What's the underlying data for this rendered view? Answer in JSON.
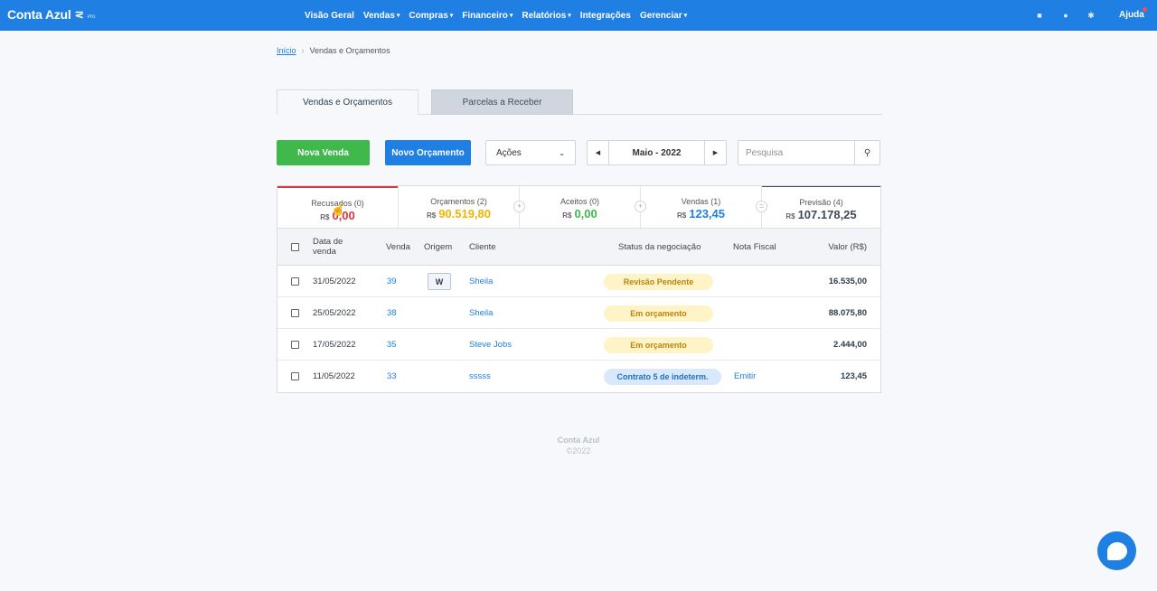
{
  "topbar": {
    "brand": "Conta Azul",
    "brand_badge": "Pro",
    "nav": [
      {
        "label": "Visão Geral",
        "dropdown": false
      },
      {
        "label": "Vendas",
        "dropdown": true
      },
      {
        "label": "Compras",
        "dropdown": true
      },
      {
        "label": "Financeiro",
        "dropdown": true
      },
      {
        "label": "Relatórios",
        "dropdown": true
      },
      {
        "label": "Integrações",
        "dropdown": false
      },
      {
        "label": "Gerenciar",
        "dropdown": true
      }
    ],
    "help": "Ajuda"
  },
  "breadcrumb": {
    "home": "Início",
    "current": "Vendas e Orçamentos"
  },
  "tabs": {
    "active": "Vendas e Orçamentos",
    "inactive": "Parcelas a Receber"
  },
  "toolbar": {
    "new_sale": "Nova Venda",
    "new_quote": "Novo Orçamento",
    "actions": "Ações",
    "period": "Maio - 2022",
    "search_placeholder": "Pesquisa"
  },
  "summary": [
    {
      "label": "Recusados (0)",
      "currency": "R$",
      "value": "0,00",
      "color": "#e0343f"
    },
    {
      "label": "Orçamentos (2)",
      "currency": "R$",
      "value": "90.519,80",
      "color": "#f0b400"
    },
    {
      "label": "Aceitos (0)",
      "currency": "R$",
      "value": "0,00",
      "color": "#3fb84c"
    },
    {
      "label": "Vendas (1)",
      "currency": "R$",
      "value": "123,45",
      "color": "#1f7fe3"
    },
    {
      "label": "Previsão (4)",
      "currency": "R$",
      "value": "107.178,25",
      "color": "#3d4a57"
    }
  ],
  "summary_ops": [
    "+",
    "+",
    "="
  ],
  "table": {
    "headers": {
      "date": "Data de venda",
      "number": "Venda",
      "origin": "Origem",
      "client": "Cliente",
      "status": "Status da negociação",
      "invoice": "Nota Fiscal",
      "value": "Valor (R$)"
    },
    "rows": [
      {
        "date": "31/05/2022",
        "number": "39",
        "origin": "W",
        "client": "Sheila",
        "status": "Revisão Pendente",
        "status_kind": "yellow",
        "invoice": "",
        "value": "16.535,00"
      },
      {
        "date": "25/05/2022",
        "number": "38",
        "origin": "",
        "client": "Sheila",
        "status": "Em orçamento",
        "status_kind": "yellow",
        "invoice": "",
        "value": "88.075,80"
      },
      {
        "date": "17/05/2022",
        "number": "35",
        "origin": "",
        "client": "Steve Jobs",
        "status": "Em orçamento",
        "status_kind": "yellow",
        "invoice": "",
        "value": "2.444,00"
      },
      {
        "date": "11/05/2022",
        "number": "33",
        "origin": "",
        "client": "sssss",
        "status": "Contrato 5 de indeterm.",
        "status_kind": "blue",
        "invoice": "Emitir",
        "value": "123,45"
      }
    ]
  },
  "footer": {
    "brand": "Conta Azul",
    "copyright": "©2022"
  }
}
